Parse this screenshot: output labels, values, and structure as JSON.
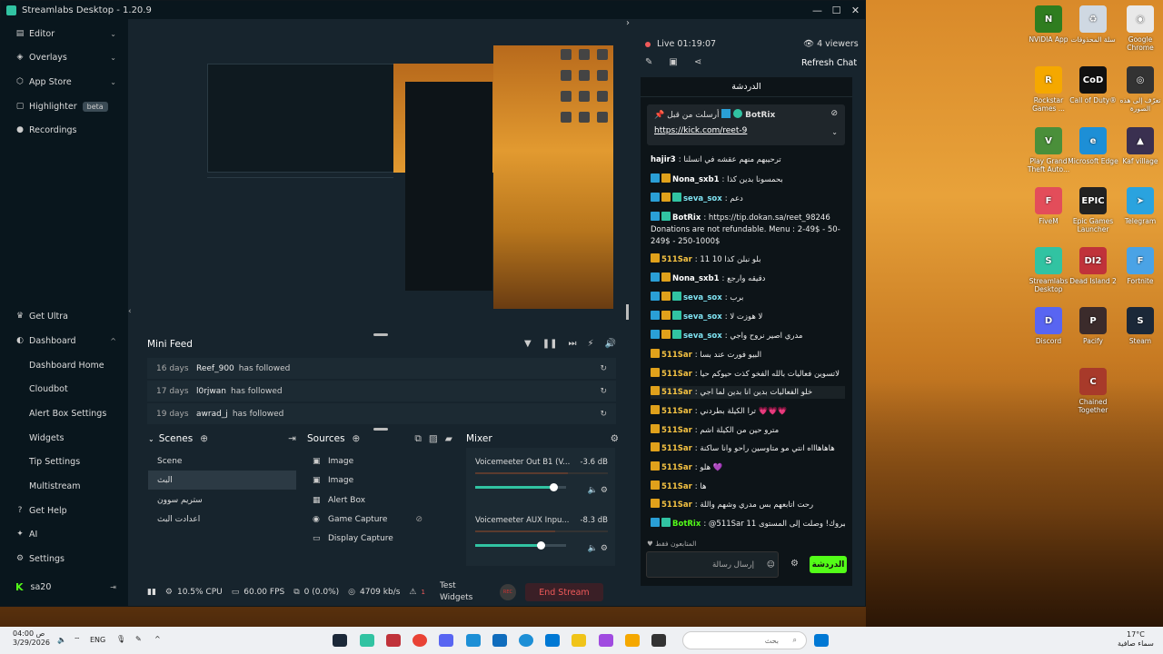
{
  "window": {
    "title": "Streamlabs Desktop - 1.20.9",
    "controls": [
      "—",
      "☐",
      "✕"
    ]
  },
  "sidebar": {
    "top": [
      {
        "label": "Editor",
        "chev": "⌄"
      },
      {
        "label": "Overlays",
        "chev": "⌄"
      },
      {
        "label": "App Store",
        "chev": "⌄"
      },
      {
        "label": "Highlighter",
        "badge": "beta"
      },
      {
        "label": "Recordings"
      }
    ],
    "bottom": [
      {
        "label": "Get Ultra"
      },
      {
        "label": "Dashboard",
        "chev": "^"
      },
      {
        "label": "Dashboard Home"
      },
      {
        "label": "Cloudbot"
      },
      {
        "label": "Alert Box Settings"
      },
      {
        "label": "Widgets"
      },
      {
        "label": "Tip Settings"
      },
      {
        "label": "Multistream"
      },
      {
        "label": "Get Help"
      },
      {
        "label": "AI"
      },
      {
        "label": "Settings"
      }
    ],
    "user": {
      "name": "sa20",
      "icon": "K"
    }
  },
  "minifeed": {
    "title": "Mini Feed",
    "rows": [
      {
        "days": "16 days",
        "name": "Reef_900",
        "action": "has followed"
      },
      {
        "days": "17 days",
        "name": "l0rjwan",
        "action": "has followed"
      },
      {
        "days": "19 days",
        "name": "awrad_j",
        "action": "has followed"
      }
    ]
  },
  "scenes": {
    "title": "Scenes",
    "items": [
      "Scene",
      "البث",
      "ستريم سوون",
      "اعدادت البث"
    ],
    "selected": 1
  },
  "sources": {
    "title": "Sources",
    "items": [
      {
        "label": "Image",
        "icon": "▣"
      },
      {
        "label": "Image",
        "icon": "▣"
      },
      {
        "label": "Alert Box",
        "icon": "▦"
      },
      {
        "label": "Game Capture",
        "icon": "◉"
      },
      {
        "label": "Display Capture",
        "icon": "▭"
      }
    ]
  },
  "mixer": {
    "title": "Mixer",
    "channels": [
      {
        "name": "Voicemeeter Out B1 (V...",
        "db": "-3.6 dB",
        "level": 0.86
      },
      {
        "name": "Voicemeeter AUX Inpu...",
        "db": "-8.3 dB",
        "level": 0.72
      }
    ]
  },
  "footer": {
    "cpu": "10.5% CPU",
    "fps": "60.00 FPS",
    "dropped": "0 (0.0%)",
    "bitrate": "4709 kb/s",
    "alert_count": "1",
    "test_widgets": "Test Widgets",
    "rec": "REC",
    "end_stream": "End Stream"
  },
  "chat": {
    "live": "Live 01:19:07",
    "viewers": "4 viewers",
    "refresh": "Refresh Chat",
    "tab": "الدردشة",
    "pinned_by": "أرسلت من قبل",
    "pinned_user": "BotRix",
    "pinned_link": "https://kick.com/reet-9",
    "messages": [
      {
        "user": "hajir3",
        "text": "ترحيبهم منهم عقشه في انسلنا",
        "badges": [],
        "ucolor": "u-white"
      },
      {
        "user": "Nona_sxb1",
        "text": "بحمسونا بدين كذا",
        "badges": [
          "b-blue",
          "b-gold"
        ],
        "ucolor": "u-white"
      },
      {
        "user": "seva_sox",
        "text": "دعم",
        "badges": [
          "b-blue",
          "b-gold",
          "b-green"
        ],
        "ucolor": "u-cyan"
      },
      {
        "user": "BotRix",
        "text": "https://tip.dokan.sa/reet_98246 Donations are not refundable. Menu : 2-49$ - 50-249$ - 250-1000$",
        "badges": [
          "b-blue",
          "b-green"
        ],
        "ucolor": "u-white",
        "wrap": true
      },
      {
        "user": "511Sar",
        "text": "11 10 بلو نبلن كذا",
        "badges": [
          "b-gold"
        ],
        "ucolor": "u-gold"
      },
      {
        "user": "Nona_sxb1",
        "text": "دقيقه وارجع",
        "badges": [
          "b-blue",
          "b-gold"
        ],
        "ucolor": "u-white"
      },
      {
        "user": "seva_sox",
        "text": "برب",
        "badges": [
          "b-blue",
          "b-gold",
          "b-green"
        ],
        "ucolor": "u-cyan"
      },
      {
        "user": "seva_sox",
        "text": "لا هوزت لا",
        "badges": [
          "b-blue",
          "b-gold",
          "b-green"
        ],
        "ucolor": "u-cyan"
      },
      {
        "user": "seva_sox",
        "text": "مدري اصير نروح واجي",
        "badges": [
          "b-blue",
          "b-gold",
          "b-green"
        ],
        "ucolor": "u-cyan"
      },
      {
        "user": "511Sar",
        "text": "البيو فورت عند بسا",
        "badges": [
          "b-gold"
        ],
        "ucolor": "u-gold"
      },
      {
        "user": "511Sar",
        "text": "لاتسوين فعاليات بالله الفخو كذت حيوكم حيا",
        "badges": [
          "b-gold"
        ],
        "ucolor": "u-gold"
      },
      {
        "user": "511Sar",
        "text": "خلو الفعاليات بدين انا بدين لما اجي",
        "badges": [
          "b-gold"
        ],
        "ucolor": "u-gold",
        "hover": true
      },
      {
        "user": "511Sar",
        "text": "ترا الكيلة بطردني 💗💗💗",
        "badges": [
          "b-gold"
        ],
        "ucolor": "u-gold"
      },
      {
        "user": "511Sar",
        "text": "مترو حين من الكيلة اشم",
        "badges": [
          "b-gold"
        ],
        "ucolor": "u-gold"
      },
      {
        "user": "511Sar",
        "text": "هاهاهاااه انتي مو متاوسين راحو وانا ساكنة",
        "badges": [
          "b-gold"
        ],
        "ucolor": "u-gold"
      },
      {
        "user": "511Sar",
        "text": "هلو 💜",
        "badges": [
          "b-gold"
        ],
        "ucolor": "u-gold"
      },
      {
        "user": "511Sar",
        "text": "ها",
        "badges": [
          "b-gold"
        ],
        "ucolor": "u-gold"
      },
      {
        "user": "511Sar",
        "text": "رحت اتابعهم بس مدري وشهم واللة",
        "badges": [
          "b-gold"
        ],
        "ucolor": "u-gold"
      },
      {
        "user": "BotRix",
        "text": "@511Sar 11 مبروك! وصلت إلى المستوى",
        "badges": [
          "b-blue",
          "b-green"
        ],
        "ucolor": "u-green"
      }
    ],
    "note": "المتابعون فقط",
    "input_placeholder": "إرسال رسالة",
    "send": "الدردشة"
  },
  "desktop_icons": [
    {
      "label": "NVIDIA App",
      "color": "#2f7d1f",
      "glyph": "N"
    },
    {
      "label": "سلة المحذوفات",
      "color": "#cfd8e2",
      "glyph": "♻"
    },
    {
      "label": "Google Chrome",
      "color": "#e9e9e9",
      "glyph": "◉"
    },
    {
      "label": "Rockstar Games ...",
      "color": "#f5a800",
      "glyph": "R"
    },
    {
      "label": "Call of Duty®",
      "color": "#111111",
      "glyph": "CoD"
    },
    {
      "label": "تعرّف إلى هذه الصورة",
      "color": "#333333",
      "glyph": "◎"
    },
    {
      "label": "Play Grand Theft Auto...",
      "color": "#4a8f3a",
      "glyph": "V"
    },
    {
      "label": "Microsoft Edge",
      "color": "#1d8fd6",
      "glyph": "e"
    },
    {
      "label": "Kaf village",
      "color": "#3a3050",
      "glyph": "▲"
    },
    {
      "label": "FiveM",
      "color": "#e34d5a",
      "glyph": "F"
    },
    {
      "label": "Epic Games Launcher",
      "color": "#222222",
      "glyph": "EPIC"
    },
    {
      "label": "Telegram",
      "color": "#2aa3df",
      "glyph": "➤"
    },
    {
      "label": "Streamlabs Desktop",
      "color": "#31c3a2",
      "glyph": "S"
    },
    {
      "label": "Dead Island 2",
      "color": "#c0323a",
      "glyph": "DI2"
    },
    {
      "label": "Fortnite",
      "color": "#4aa3e6",
      "glyph": "F"
    },
    {
      "label": "Discord",
      "color": "#5865f2",
      "glyph": "D"
    },
    {
      "label": "Pacify",
      "color": "#3b2b2b",
      "glyph": "P"
    },
    {
      "label": "Steam",
      "color": "#1b2838",
      "glyph": "S"
    },
    {
      "label": "Chained Together",
      "color": "#a83a2a",
      "glyph": "C"
    }
  ],
  "taskbar": {
    "time": "04:00 ص",
    "date": "3/29/2026",
    "lang": "ENG",
    "search": "بحث",
    "weather_temp": "17°C",
    "weather_desc": "سماء صافية"
  }
}
